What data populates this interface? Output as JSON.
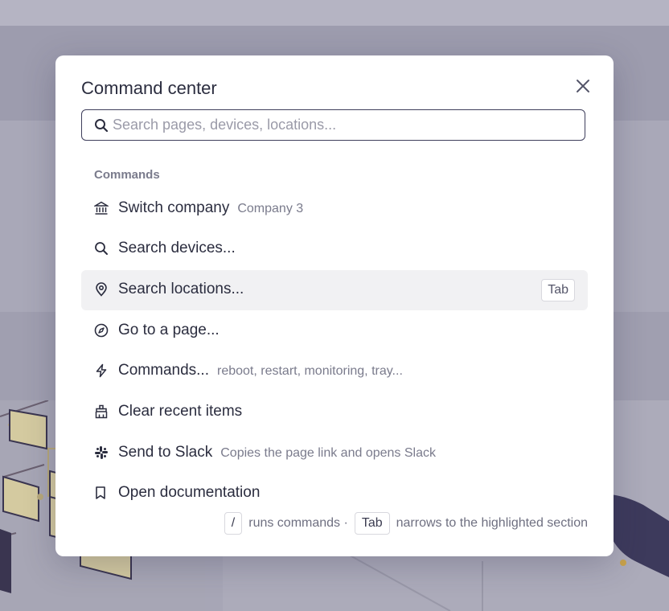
{
  "modal": {
    "title": "Command center",
    "search_placeholder": "Search pages, devices, locations..."
  },
  "commands": {
    "group_label": "Commands",
    "items": [
      {
        "label": "Switch company",
        "hint": "Company 3",
        "icon": "bank-icon"
      },
      {
        "label": "Search devices...",
        "icon": "search-icon"
      },
      {
        "label": "Search locations...",
        "shortcut": "Tab",
        "icon": "map-pin-icon",
        "active": true
      },
      {
        "label": "Go to a page...",
        "icon": "compass-icon"
      },
      {
        "label": "Commands...",
        "hint": "reboot, restart, monitoring, tray...",
        "icon": "lightning-icon"
      },
      {
        "label": "Clear recent items",
        "icon": "broom-icon"
      },
      {
        "label": "Send to Slack",
        "hint": "Copies the page link and opens Slack",
        "icon": "slack-icon"
      },
      {
        "label": "Open documentation",
        "icon": "book-icon"
      }
    ]
  },
  "footer": {
    "key1": "/",
    "text1": "runs commands ·",
    "key2": "Tab",
    "text2": "narrows to the highlighted section"
  }
}
